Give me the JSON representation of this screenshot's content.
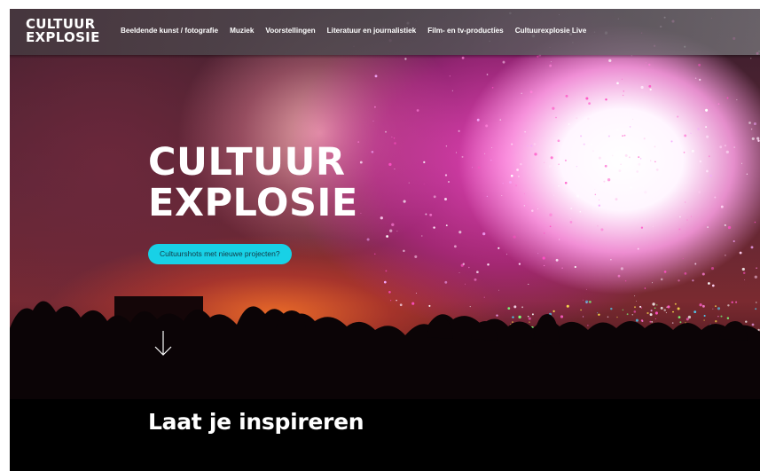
{
  "logo": {
    "line1": "CULTUUR",
    "line2": "EXPLOSIE"
  },
  "nav": {
    "items": [
      {
        "label": "Beeldende kunst / fotografie"
      },
      {
        "label": "Muziek"
      },
      {
        "label": "Voorstellingen"
      },
      {
        "label": "Literatuur en journalistiek"
      },
      {
        "label": "Film- en tv-producties"
      },
      {
        "label": "Cultuurexplosie Live"
      }
    ]
  },
  "hero": {
    "title_line1": "CULTUUR",
    "title_line2": "EXPLOSIE",
    "cta_label": "Cultuurshots met nieuwe projecten?",
    "scroll_icon": "arrow-down-icon"
  },
  "section": {
    "title": "Laat je inspireren"
  },
  "colors": {
    "accent": "#18d1e6",
    "cta_text": "#133b47",
    "nav_bg": "#56505a",
    "page_bg": "#000000",
    "text": "#ffffff"
  }
}
